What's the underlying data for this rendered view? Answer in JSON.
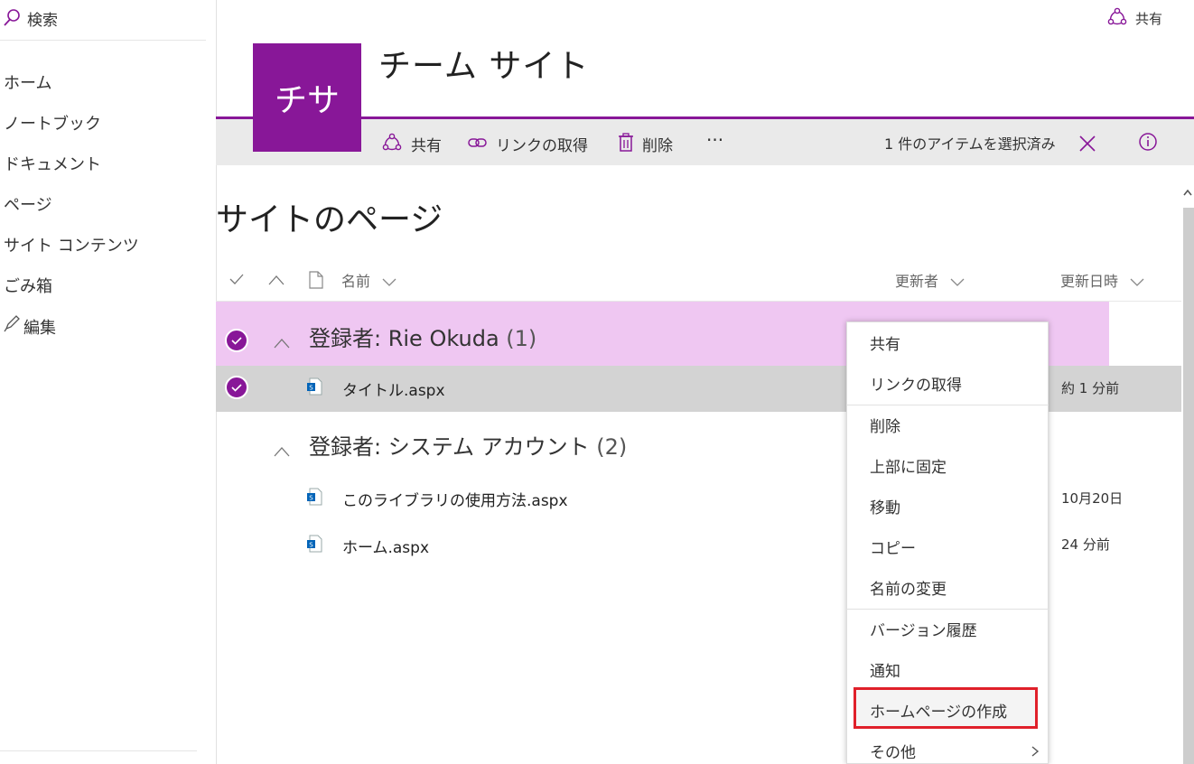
{
  "colors": {
    "accent": "#881798",
    "selected_group": "#efc7f2",
    "selected_row": "#d3d3d3",
    "highlight": "#e0202a"
  },
  "leftnav": {
    "search_label": "検索",
    "items": [
      "ホーム",
      "ノートブック",
      "ドキュメント",
      "ページ",
      "サイト コンテンツ",
      "ごみ箱"
    ],
    "edit_label": "編集"
  },
  "header": {
    "share_label": "共有",
    "logo_text": "チサ",
    "site_title": "チーム サイト"
  },
  "commandbar": {
    "share": "共有",
    "get_link": "リンクの取得",
    "delete": "削除",
    "more": "···",
    "selection": "1 件のアイテムを選択済み"
  },
  "main": {
    "title": "サイトのページ",
    "columns": {
      "name": "名前",
      "modified_by": "更新者",
      "modified": "更新日時"
    },
    "groups": [
      {
        "title": "登録者: Rie Okuda",
        "count": "(1)",
        "rows": [
          {
            "name": "タイトル.aspx",
            "modified": "約 1 分前"
          }
        ]
      },
      {
        "title": "登録者: システム アカウント",
        "count": "(2)",
        "rows": [
          {
            "name": "このライブラリの使用方法.aspx",
            "modified": "10月20日"
          },
          {
            "name": "ホーム.aspx",
            "modified": "24 分前"
          }
        ]
      }
    ]
  },
  "contextmenu": {
    "items": [
      "共有",
      "リンクの取得",
      "削除",
      "上部に固定",
      "移動",
      "コピー",
      "名前の変更",
      "バージョン履歴",
      "通知",
      "ホームページの作成",
      "その他"
    ]
  }
}
